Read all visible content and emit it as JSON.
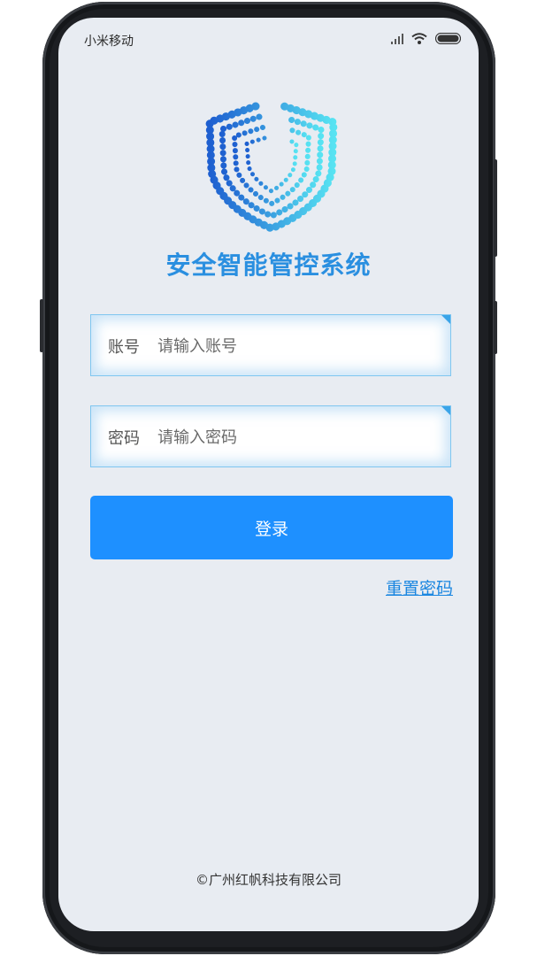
{
  "status_bar": {
    "carrier": "小米移动",
    "icons": [
      "signal-icon",
      "wifi-icon",
      "battery-icon"
    ]
  },
  "app": {
    "logo_icon": "shield-logo-icon",
    "title": "安全智能管控系统",
    "title_color": "#2a8fe0"
  },
  "form": {
    "account": {
      "label": "账号",
      "placeholder": "请输入账号",
      "value": ""
    },
    "password": {
      "label": "密码",
      "placeholder": "请输入密码",
      "value": ""
    },
    "login_label": "登录",
    "reset_label": "重置密码"
  },
  "footer": {
    "copyright": "©广州红帆科技有限公司"
  },
  "colors": {
    "primary": "#1e90ff",
    "link": "#1a86e0",
    "background": "#e8ecf2",
    "field_border": "#7fc6f0"
  }
}
